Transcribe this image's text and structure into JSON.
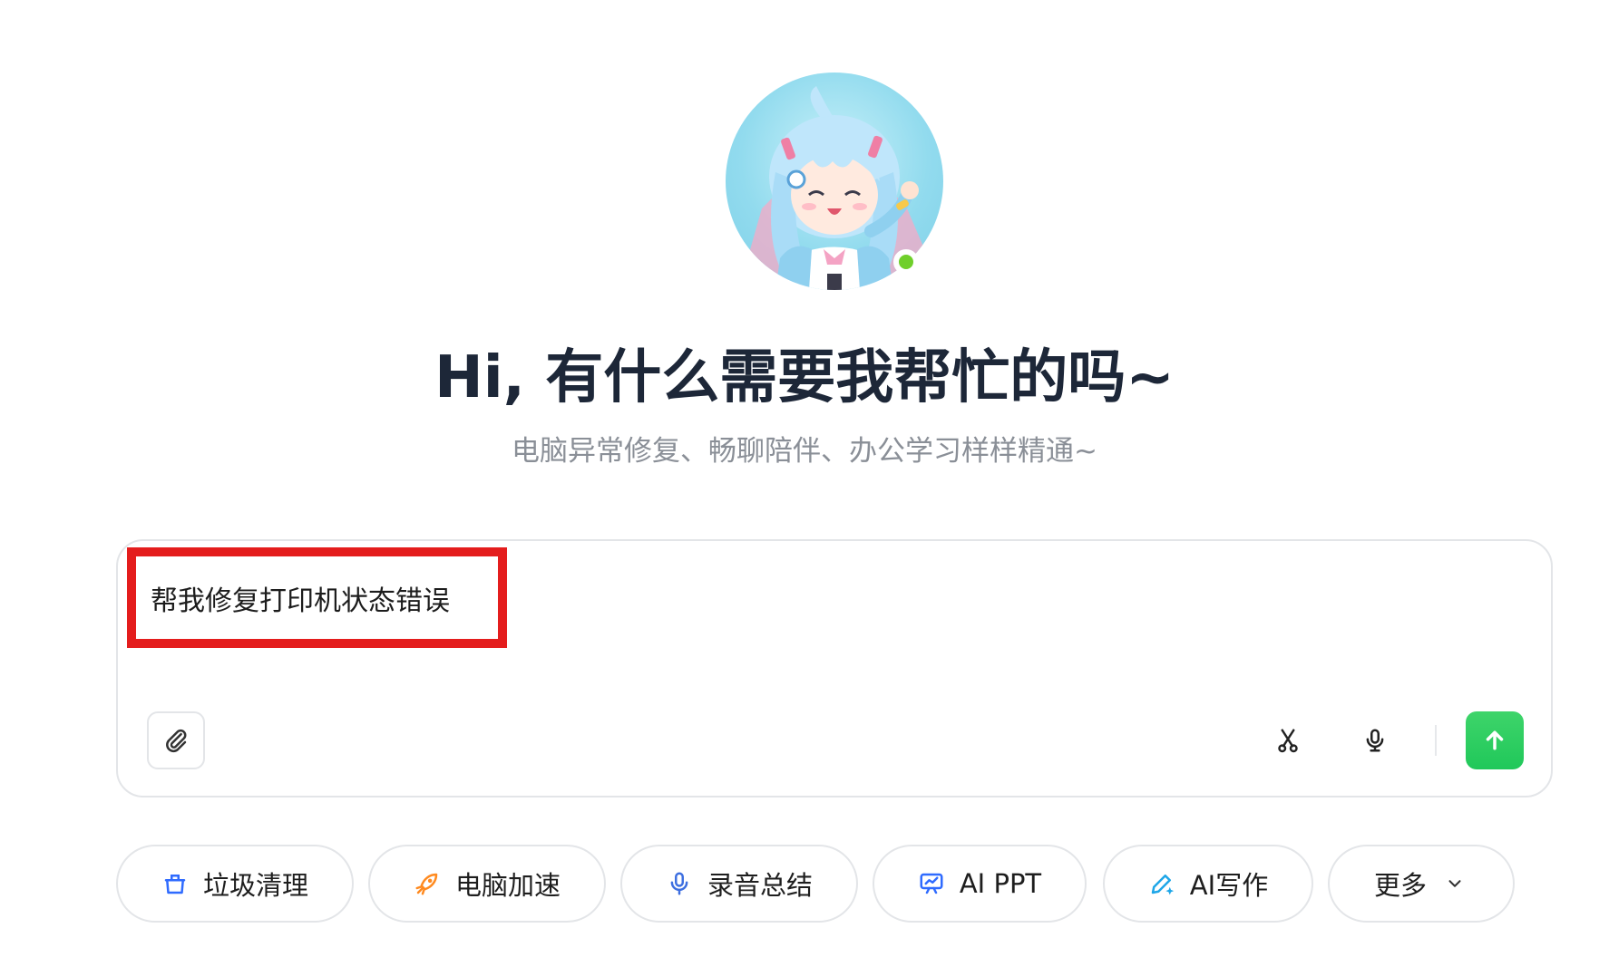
{
  "assistant": {
    "status": "online"
  },
  "greeting": {
    "title": "Hi, 有什么需要我帮忙的吗~",
    "subtitle": "电脑异常修复、畅聊陪伴、办公学习样样精通~"
  },
  "composer": {
    "text": "帮我修复打印机状态错误"
  },
  "quick_actions": [
    {
      "label": "垃圾清理",
      "icon": "cleanup-icon",
      "color": "#2f6bff"
    },
    {
      "label": "电脑加速",
      "icon": "rocket-icon",
      "color": "#ff8a1f"
    },
    {
      "label": "录音总结",
      "icon": "microphone-icon",
      "color": "#3d6fe0"
    },
    {
      "label": "AI PPT",
      "icon": "presentation-icon",
      "color": "#2f6bff"
    },
    {
      "label": "AI写作",
      "icon": "pen-sparkle-icon",
      "color": "#1ea6e8"
    },
    {
      "label": "更多",
      "icon": "chevron-down-icon",
      "color": "#333333"
    }
  ],
  "colors": {
    "title": "#1d2738",
    "subtitle": "#8a8f97",
    "send": "#2ecc5f",
    "online": "#6fcf2a",
    "highlight": "#e41d1d"
  }
}
